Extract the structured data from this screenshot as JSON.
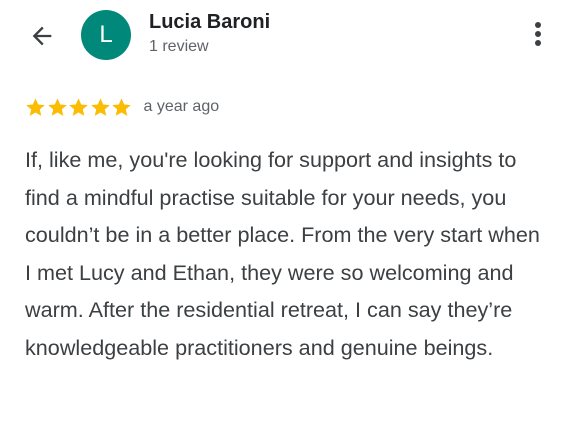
{
  "reviewer": {
    "initial": "L",
    "name": "Lucia Baroni",
    "review_count": "1 review",
    "avatar_color": "#00897b"
  },
  "review": {
    "rating": 5,
    "max_rating": 5,
    "star_color": "#fbbc04",
    "date": "a year ago",
    "text": "If, like me, you're looking for support and insights to find a mindful practise suitable for your needs, you couldn’t be in a better place. From the very start when I met Lucy and Ethan, they were so welcoming and warm. After the residential retreat, I can say they’re knowledgeable practitioners and genuine beings."
  },
  "icons": {
    "back": "arrow-left-icon",
    "menu": "more-vert-icon",
    "star": "star-icon"
  }
}
